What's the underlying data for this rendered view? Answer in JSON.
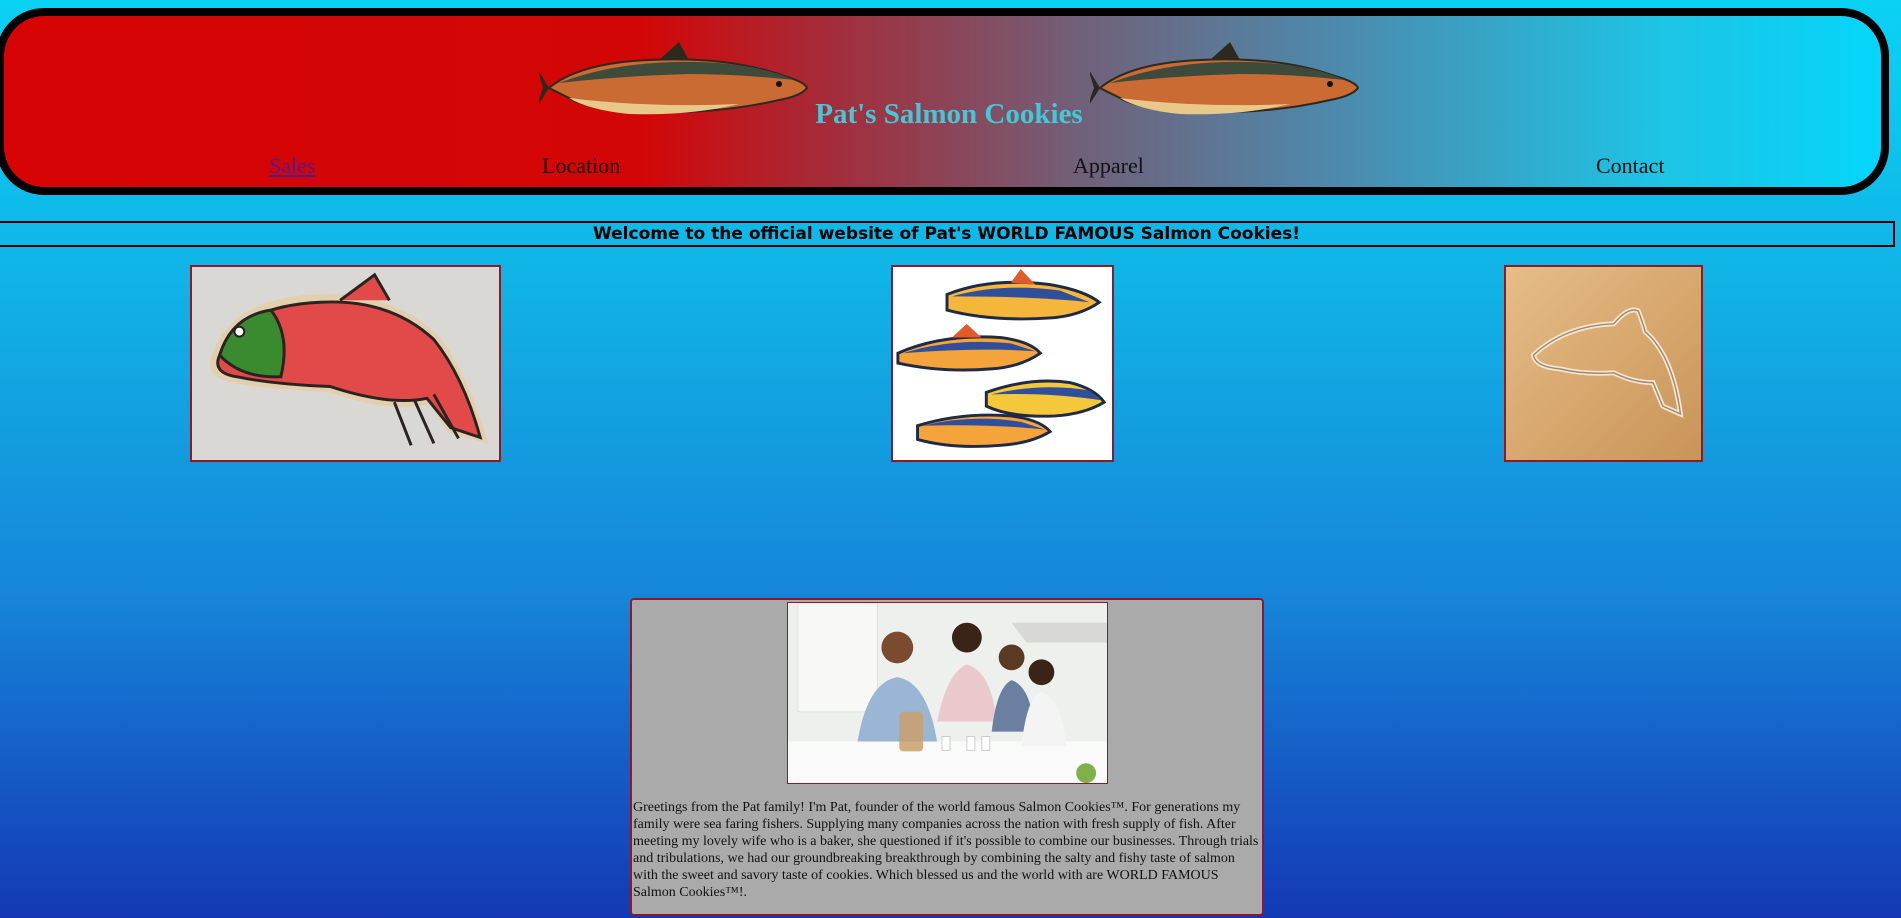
{
  "header": {
    "site_title": "Pat's Salmon Cookies",
    "nav": {
      "sales": "Sales",
      "location": "Location",
      "apparel": "Apparel",
      "contact": "Contact"
    }
  },
  "welcome": "Welcome to the official website of Pat's WORLD FAMOUS Salmon Cookies!",
  "about": {
    "text": "Greetings from the Pat family! I'm Pat, founder of the world famous Salmon Cookies™. For generations my family were sea faring fishers. Supplying many companies across the nation with fresh supply of fish. After meeting my lovely wife who is a baker, she questioned if it's possible to combine our businesses. Through trials and tribulations, we had our groundbreaking breakthrough by combining the salty and fishy taste of salmon with the sweet and savory taste of cookies. Which blessed us and the world with are WORLD FAMOUS Salmon Cookies™!."
  },
  "colors": {
    "header_red": "#d60404",
    "header_cyan": "#05d6fa",
    "title_color": "#44c7d6",
    "frame_border": "#8a1b2b",
    "about_bg": "#aaaaaa",
    "visited_link": "#551a8b"
  }
}
